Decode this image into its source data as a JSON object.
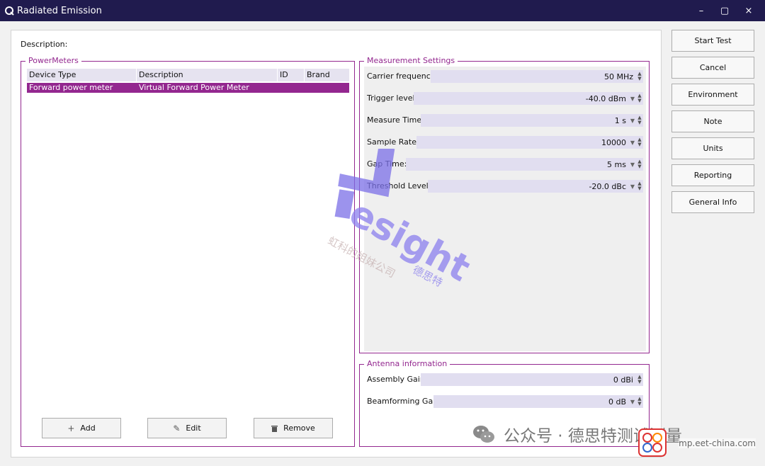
{
  "window": {
    "title": "Radiated Emission",
    "minimize": "–",
    "maximize": "▢",
    "close": "×"
  },
  "description_label": "Description:",
  "power_meters": {
    "legend": "PowerMeters",
    "columns": [
      "Device Type",
      "Description",
      "ID",
      "Brand"
    ],
    "rows": [
      {
        "device_type": "Forward power meter",
        "description": "Virtual Forward Power Meter",
        "id": "",
        "brand": ""
      }
    ],
    "buttons": {
      "add": "Add",
      "edit": "Edit",
      "remove": "Remove"
    }
  },
  "measurement_settings": {
    "legend": "Measurement Settings",
    "fields": [
      {
        "label": "Carrier frequency:",
        "value": "50 MHz",
        "has_dropdown": false
      },
      {
        "label": "Trigger level:",
        "value": "-40.0 dBm",
        "has_dropdown": true
      },
      {
        "label": "Measure Time:",
        "value": "1 s",
        "has_dropdown": true
      },
      {
        "label": "Sample Rate:",
        "value": "10000",
        "has_dropdown": true
      },
      {
        "label": "Gap Time:",
        "value": "5 ms",
        "has_dropdown": true
      },
      {
        "label": "Threshold Level:",
        "value": "-20.0 dBc",
        "has_dropdown": true
      }
    ]
  },
  "antenna": {
    "legend": "Antenna information",
    "fields": [
      {
        "label": "Assembly Gain:",
        "value": "0 dBi",
        "has_dropdown": false
      },
      {
        "label": "Beamforming Gain:",
        "value": "0 dB",
        "has_dropdown": true
      }
    ]
  },
  "side_buttons": {
    "start_test": "Start Test",
    "cancel": "Cancel",
    "environment": "Environment",
    "note": "Note",
    "units": "Units",
    "reporting": "Reporting",
    "general_info": "General Info"
  },
  "watermark": {
    "brand": "esight",
    "chinese_brand": "德思特",
    "chinese_slogan": "虹科的姐妹公司"
  },
  "overlay": {
    "wechat_text": "公众号 · 德思特测试测量",
    "site": "mp.eet-china.com"
  },
  "colors": {
    "accent": "#93278f",
    "titlebar": "#201b4e",
    "spin_bg": "#e1def0"
  }
}
